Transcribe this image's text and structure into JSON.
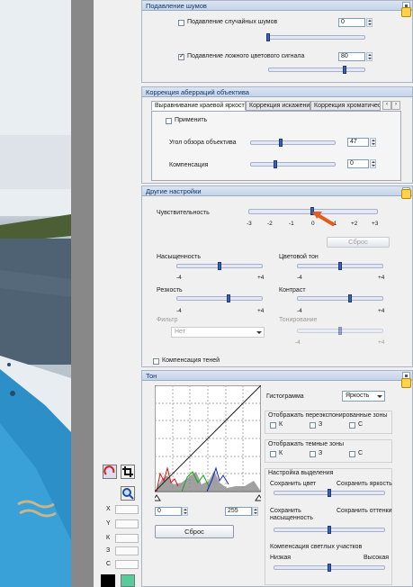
{
  "noise_panel": {
    "title": "Подавление шумов",
    "random_noise_label": "Подавление случайных шумов",
    "random_noise_value": "0",
    "random_noise_checked": false,
    "false_color_label": "Подавление ложного цветового сигнала",
    "false_color_value": "80",
    "false_color_checked": true
  },
  "aberration_panel": {
    "title": "Коррекция аберраций объектива",
    "tabs": [
      "Выравнивание краевой яркости",
      "Коррекция искажений",
      "Коррекция хроматичес"
    ],
    "apply_label": "Применить",
    "angle_label": "Угол обзора объектива",
    "angle_value": "47",
    "compensation_label": "Компенсация",
    "compensation_value": "0"
  },
  "other_panel": {
    "title": "Другие настройки",
    "sensitivity_label": "Чувствительность",
    "scale": [
      "-3",
      "-2",
      "-1",
      "0",
      "+1",
      "+2",
      "+3"
    ],
    "reset_label": "Сброс",
    "saturation_label": "Насыщенность",
    "hue_label": "Цветовой тон",
    "sharpness_label": "Резкость",
    "contrast_label": "Контраст",
    "filter_label": "Фильтр",
    "filter_value": "Нет",
    "toning_label": "Тонирование",
    "min4": "-4",
    "max4": "+4",
    "shadow_comp_label": "Компенсация теней"
  },
  "tone_panel": {
    "title": "Тон",
    "histogram_label": "Гистограмма",
    "histogram_mode": "Яркость",
    "over_label": "Отображать переэкспонированные зоны",
    "dark_label": "Отображать темные зоны",
    "ch_k": "К",
    "ch_z": "З",
    "ch_s": "С",
    "highlight_label": "Настройка выделения",
    "keep_color": "Сохранить цвет",
    "keep_brightness": "Сохранить яркость",
    "keep_saturation": "Сохранить насыщенность",
    "keep_shades": "Сохранить оттенки",
    "bright_comp_label": "Компенсация светлых участков",
    "low_label": "Низкая",
    "high_label": "Высокая",
    "in_min": "0",
    "in_max": "255",
    "reset_label": "Сброс"
  },
  "info": {
    "x": "X",
    "y": "Y",
    "k": "К",
    "z": "З",
    "c": "С"
  }
}
